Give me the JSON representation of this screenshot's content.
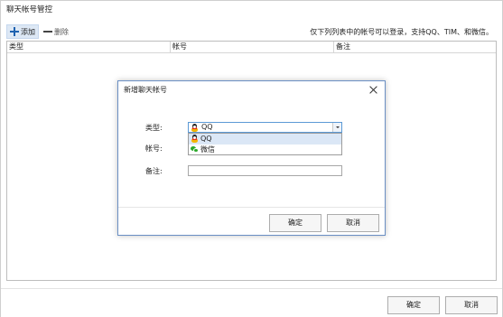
{
  "window": {
    "title": "聊天帐号管控"
  },
  "toolbar": {
    "add_label": "添加",
    "delete_label": "删除"
  },
  "notice": "仅下列列表中的帐号可以登录，支持QQ、TIM、和微信。",
  "grid": {
    "columns": [
      "类型",
      "帐号",
      "备注"
    ]
  },
  "footer": {
    "ok_label": "确定",
    "cancel_label": "取消"
  },
  "dialog": {
    "title": "新增聊天帐号",
    "type_label": "类型:",
    "account_label": "帐号:",
    "remark_label": "备注:",
    "type_value": "QQ",
    "options": [
      {
        "label": "QQ",
        "icon": "qq-icon"
      },
      {
        "label": "微信",
        "icon": "wechat-icon"
      }
    ],
    "ok_label": "确定",
    "cancel_label": "取消"
  },
  "colors": {
    "accent": "#5c9ad6",
    "selection": "#dbe7f6",
    "dialog_border": "#6a8fc4"
  }
}
